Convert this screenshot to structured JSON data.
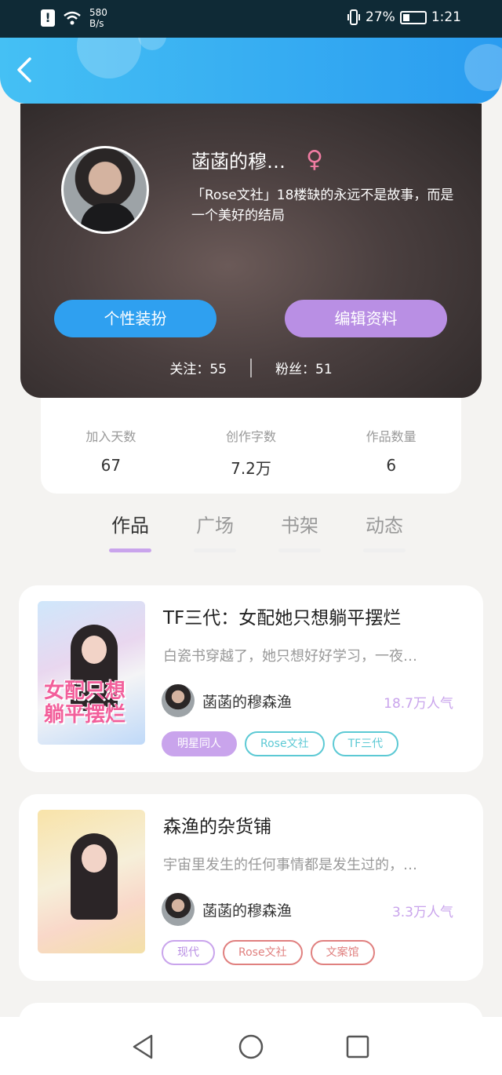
{
  "status": {
    "net_speed_value": "580",
    "net_speed_unit": "B/s",
    "battery_percent": "27%",
    "time": "1:21"
  },
  "profile": {
    "nickname": "菡菡的穆…",
    "gender_symbol": "♀",
    "bio": "「Rose文社」18楼缺的永远不是故事，而是一个美好的结局",
    "dress_button": "个性装扮",
    "edit_button": "编辑资料",
    "following": "关注：55",
    "fans": "粉丝：51"
  },
  "stats": [
    {
      "label": "加入天数",
      "value": "67"
    },
    {
      "label": "创作字数",
      "value": "7.2万"
    },
    {
      "label": "作品数量",
      "value": "6"
    }
  ],
  "tabs": [
    "作品",
    "广场",
    "书架",
    "动态"
  ],
  "works": [
    {
      "title": "TF三代：女配她只想躺平摆烂",
      "intro": "白瓷书穿越了，她只想好好学习，一夜…",
      "author": "菡菡的穆森渔",
      "popularity": "18.7万人气",
      "cover_text": "女配只想躺平摆烂",
      "tags": [
        "明星同人",
        "Rose文社",
        "TF三代"
      ]
    },
    {
      "title": "森渔的杂货铺",
      "intro": "宇宙里发生的任何事情都是发生过的，…",
      "author": "菡菡的穆森渔",
      "popularity": "3.3万人气",
      "tags": [
        "现代",
        "Rose文社",
        "文案馆"
      ]
    }
  ],
  "colors": {
    "header": "#2a9cf0",
    "accent_purple": "#b98fe4",
    "accent_blue": "#2fa0f0",
    "tag_cyan": "#5cc9d4",
    "tag_red": "#e0807f"
  }
}
